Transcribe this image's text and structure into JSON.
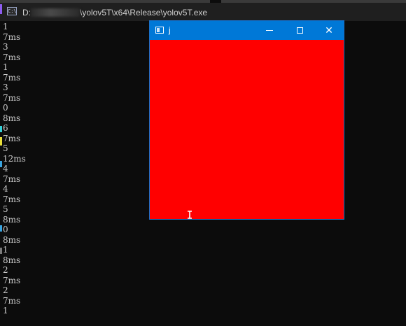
{
  "console": {
    "title_prefix": "D:",
    "title_suffix": "\\yolov5T\\x64\\Release\\yolov5T.exe",
    "icon": "console-app-icon",
    "icon_text": "C:\\",
    "lines": [
      "1",
      "7ms",
      "3",
      "7ms",
      "1",
      "7ms",
      "3",
      "7ms",
      "0",
      "8ms",
      "6",
      "7ms",
      "5",
      "12ms",
      "4",
      "7ms",
      "4",
      "7ms",
      "5",
      "8ms",
      "0",
      "8ms",
      "1",
      "8ms",
      "2",
      "7ms",
      "2",
      "7ms",
      "1"
    ]
  },
  "popup": {
    "title": "j",
    "icon": "window-app-icon",
    "canvas_color": "#ff0000",
    "titlebar_color": "#0078d7",
    "buttons": {
      "minimize": "minimize-icon",
      "maximize": "maximize-icon",
      "close_label": "✕"
    }
  },
  "colors": {
    "console_bg": "#0c0c0c",
    "console_text": "#cccccc",
    "accent_blue": "#0078d7"
  }
}
